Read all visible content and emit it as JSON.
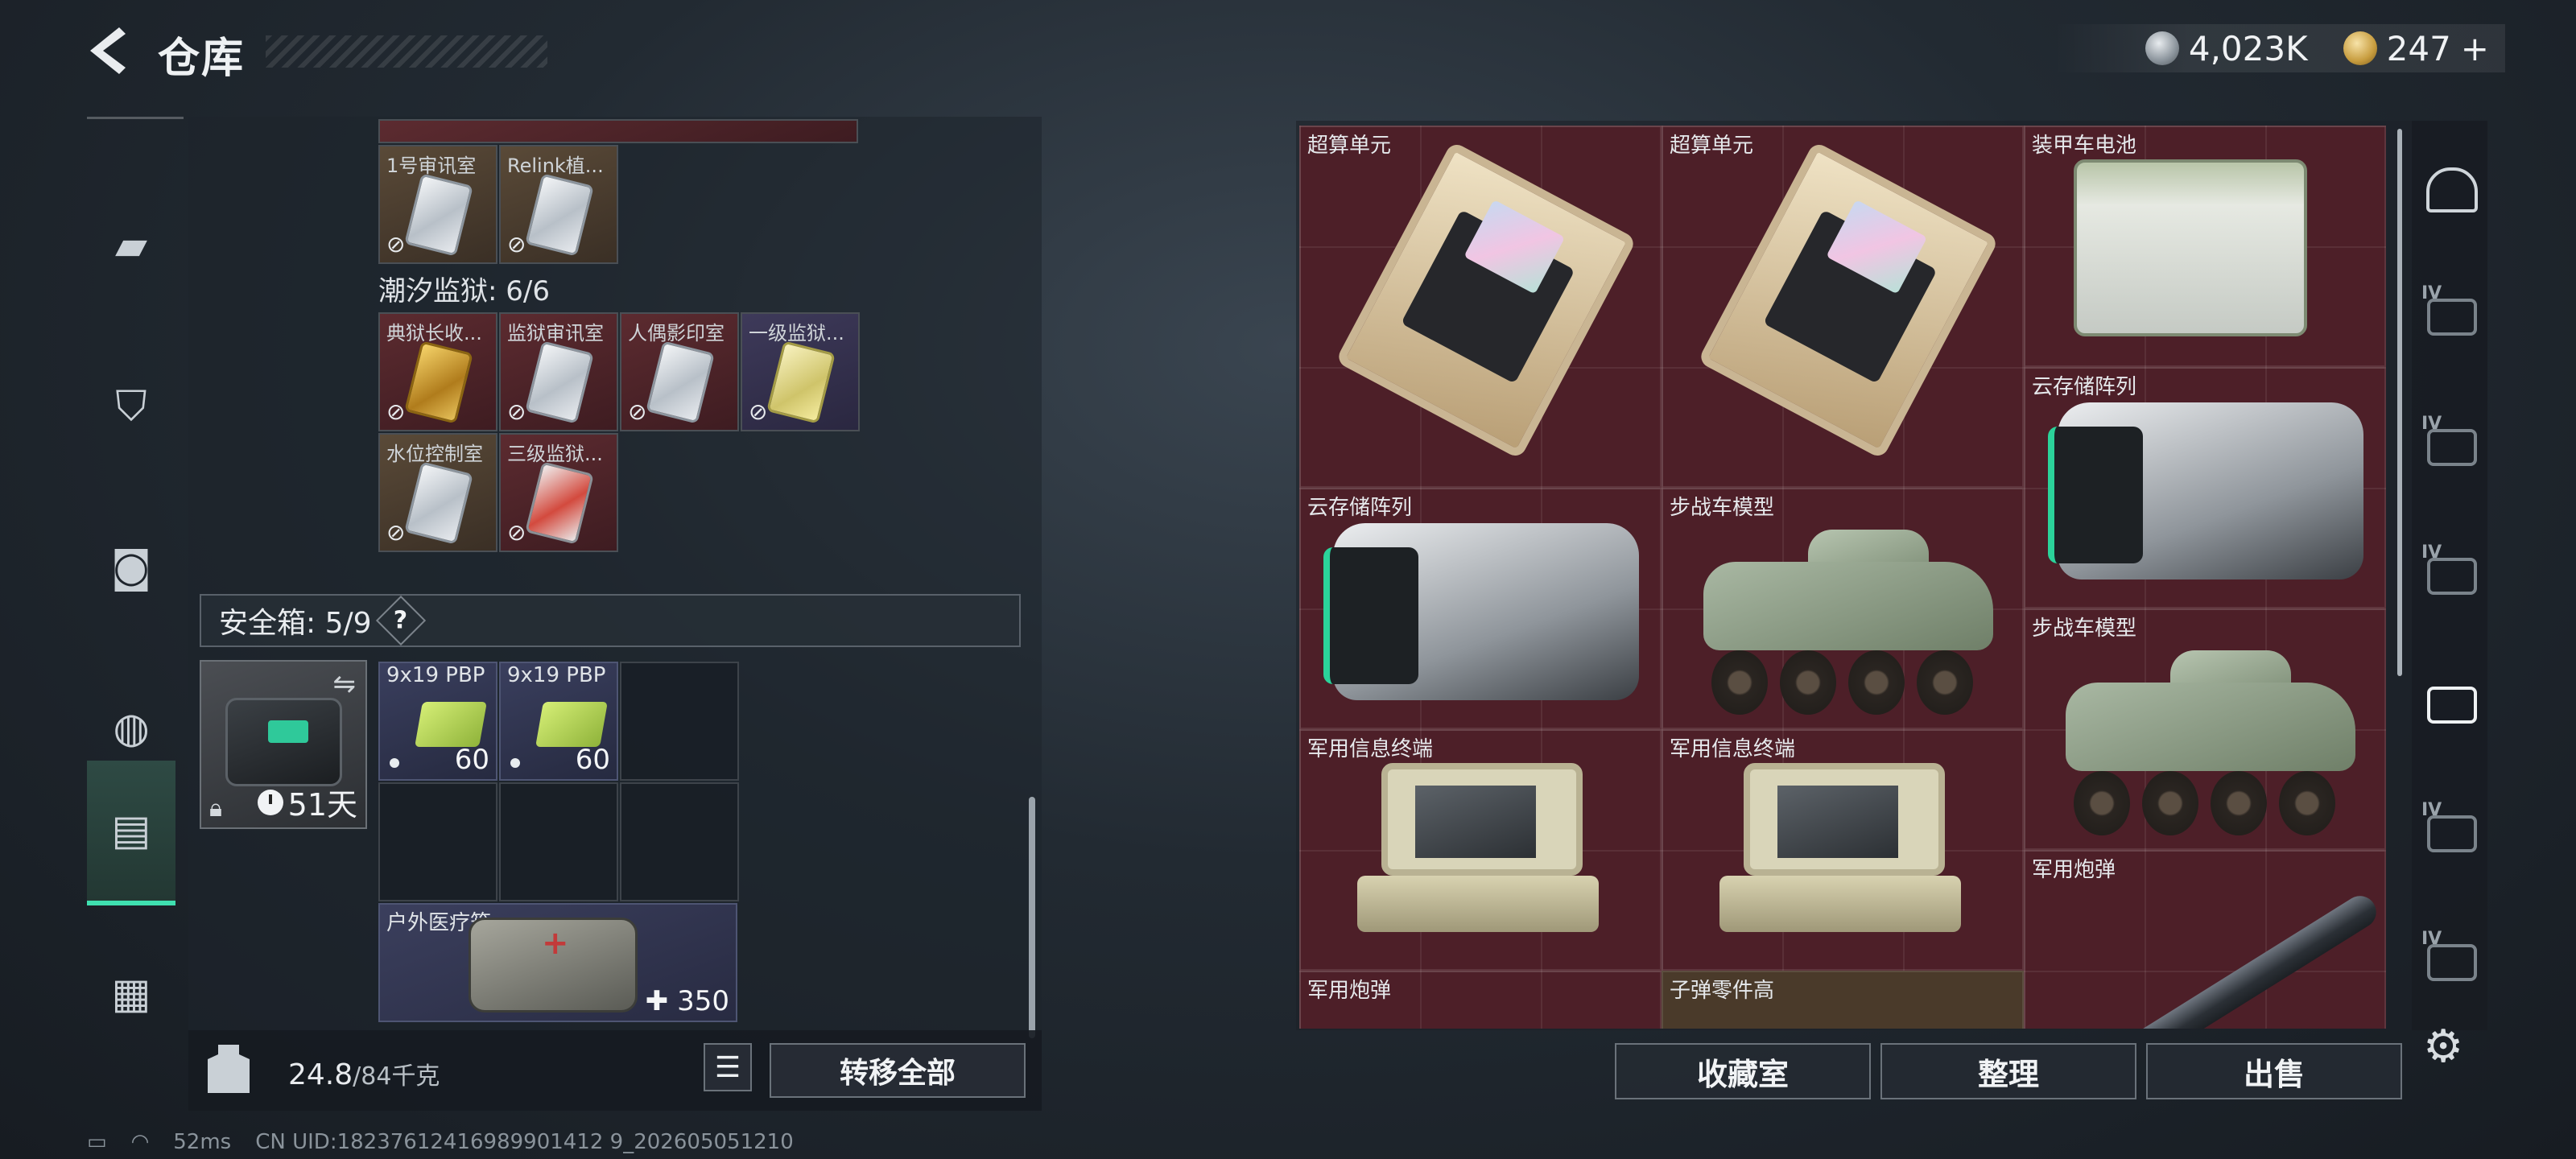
{
  "header": {
    "title": "仓库",
    "currency_silver": "4,023K",
    "currency_gold": "247",
    "gold_plus": "+"
  },
  "left_nav": {
    "items": [
      {
        "icon": "gun-icon"
      },
      {
        "icon": "vest-icon"
      },
      {
        "icon": "backpack-icon"
      },
      {
        "icon": "bag-icon"
      },
      {
        "icon": "clipboard-icon"
      },
      {
        "icon": "briefcase-icon"
      }
    ],
    "active_index": 4
  },
  "stash": {
    "row1_labels": [
      "1号审讯室",
      "Relink植..."
    ],
    "section_title": "潮汐监狱: 6/6",
    "prison_labels": [
      "典狱长收...",
      "监狱审讯室",
      "人偶影印室",
      "一级监狱...",
      "水位控制室",
      "三级监狱..."
    ]
  },
  "safe_box": {
    "title": "安全箱: 5/9",
    "help": "?",
    "days": "51天",
    "ammo": [
      {
        "label": "9x19 PBP",
        "qty": "60"
      },
      {
        "label": "9x19 PBP",
        "qty": "60"
      }
    ],
    "medkit_label": "户外医疗箱",
    "medkit_qty": "350"
  },
  "weight": {
    "current": "24.8",
    "capacity": "/84千克"
  },
  "buttons": {
    "transfer_all": "转移全部",
    "collection_room": "收藏室",
    "organize": "整理",
    "sell": "出售"
  },
  "status_bar": {
    "ping": "52ms",
    "uid": "CN UID:18237612416989901412 9_202605051210"
  },
  "warehouse_items": [
    {
      "label": "超算单元"
    },
    {
      "label": "超算单元"
    },
    {
      "label": "装甲车电池"
    },
    {
      "label": "云存储阵列"
    },
    {
      "label": "云存储阵列"
    },
    {
      "label": "步战车模型"
    },
    {
      "label": "步战车模型"
    },
    {
      "label": "军用信息终端"
    },
    {
      "label": "军用信息终端"
    },
    {
      "label": "军用炮弹"
    },
    {
      "label": "军用炮弹"
    },
    {
      "label": "子弹零件高"
    }
  ],
  "right_nav": {
    "tiers": [
      "IV",
      "IV",
      "IV",
      "",
      "IV",
      "IV"
    ]
  },
  "colors": {
    "accent": "#3fe0b0",
    "warehouse_bg": "#4d1f28"
  }
}
